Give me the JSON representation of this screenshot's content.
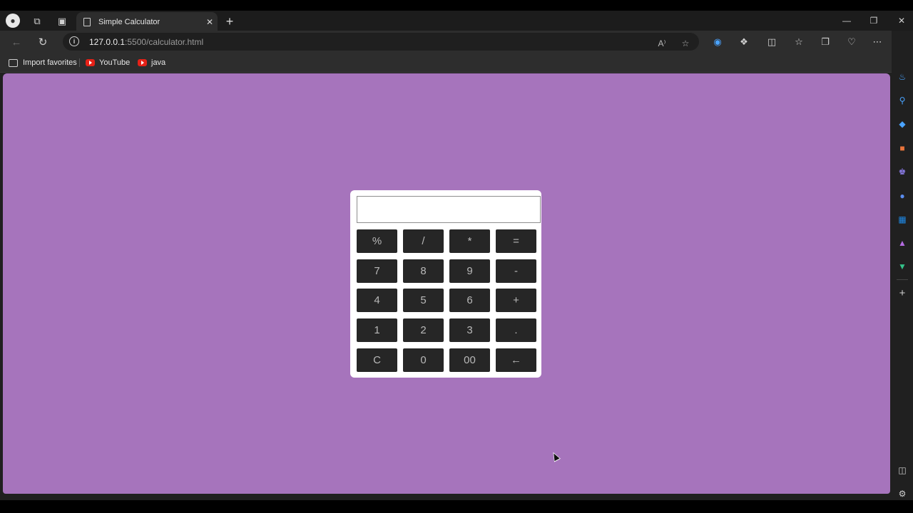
{
  "tabs": [
    {
      "title": "Simple Calculator"
    }
  ],
  "address": {
    "host": "127.0.0.1",
    "path": ":5500/calculator.html"
  },
  "bookmarks": [
    {
      "label": "Import favorites",
      "icon": "import-icon"
    },
    {
      "label": "YouTube",
      "icon": "youtube-icon"
    },
    {
      "label": "java",
      "icon": "youtube-icon"
    }
  ],
  "page": {
    "background": "#a674bc"
  },
  "calculator": {
    "display_value": "",
    "keys": [
      [
        "%",
        "/",
        "*",
        "="
      ],
      [
        "7",
        "8",
        "9",
        "-"
      ],
      [
        "4",
        "5",
        "6",
        "+"
      ],
      [
        "1",
        "2",
        "3",
        "."
      ],
      [
        "C",
        "0",
        "00",
        "←"
      ]
    ]
  }
}
